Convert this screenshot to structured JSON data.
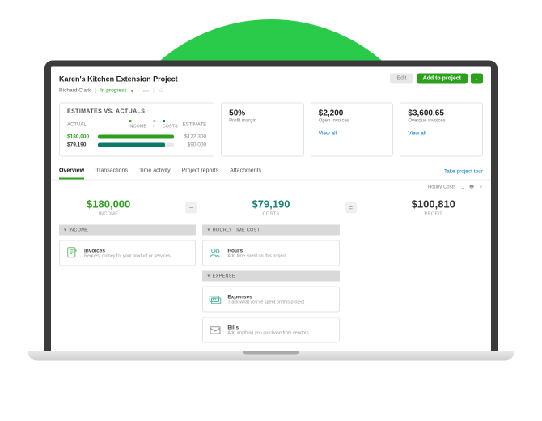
{
  "header": {
    "title": "Karen's Kitchen Extension Project",
    "owner": "Richard Clark",
    "status": "In progress",
    "edit": "Edit",
    "add": "Add to project"
  },
  "estimates": {
    "title": "ESTIMATES VS. ACTUALS",
    "actual_label": "ACTUAL",
    "estimate_label": "ESTIMATE",
    "legend_income": "INCOME",
    "legend_costs": "COSTS",
    "income_actual": "$180,000",
    "income_estimate": "$172,300",
    "income_fill_color": "#2CA01C",
    "income_fill_pct": 100,
    "costs_actual": "$79,190",
    "costs_estimate": "$90,000",
    "costs_fill_color": "#0a7a68",
    "costs_fill_pct": 88
  },
  "stats": {
    "margin_value": "50%",
    "margin_label": "Profit margin",
    "open_value": "$2,200",
    "open_label": "Open invoices",
    "overdue_value": "$3,600.65",
    "overdue_label": "Overdue invoices",
    "view_all": "View all"
  },
  "tabs": {
    "overview": "Overview",
    "transactions": "Transactions",
    "time": "Time activity",
    "reports": "Project reports",
    "attachments": "Attachments",
    "tour": "Take project tour"
  },
  "subbar": {
    "hourly": "Hourly Costs"
  },
  "math": {
    "income_val": "$180,000",
    "income_lbl": "INCOME",
    "costs_val": "$79,190",
    "costs_lbl": "COSTS",
    "profit_val": "$100,810",
    "profit_lbl": "PROFIT"
  },
  "sections": {
    "income_h": "INCOME",
    "hourly_h": "HOURLY TIME COST",
    "expense_h": "EXPENSE",
    "items": {
      "invoices_t": "Invoices",
      "invoices_s": "Request money for your product or services",
      "hours_t": "Hours",
      "hours_s": "Add time spent on this project",
      "expenses_t": "Expenses",
      "expenses_s": "Track what you've spent on this project",
      "bills_t": "Bills",
      "bills_s": "Add anything you purchase from vendors"
    }
  }
}
